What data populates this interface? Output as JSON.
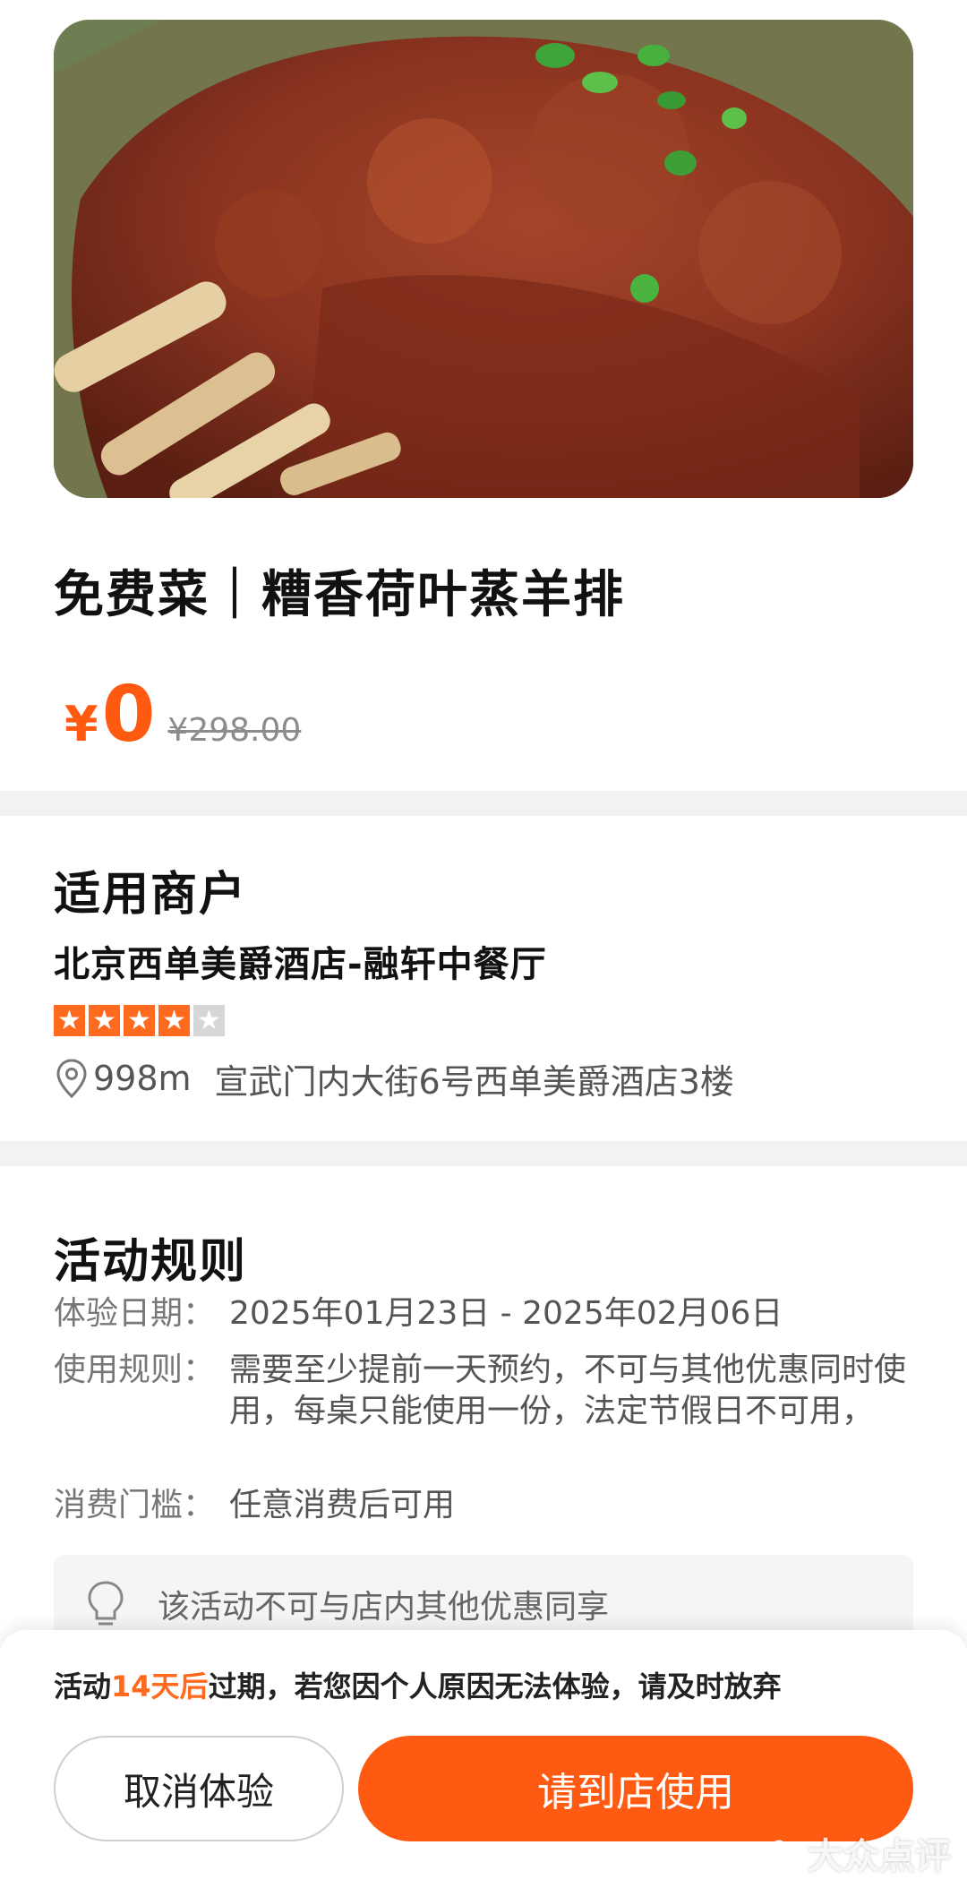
{
  "dish": {
    "title": "免费菜｜糟香荷叶蒸羊排",
    "price_symbol": "¥",
    "price_now": "0",
    "price_original": "¥298.00",
    "image_icon": "lamb-ribs-photo"
  },
  "merchant": {
    "section_title": "适用商户",
    "name": "北京西单美爵酒店-融轩中餐厅",
    "rating_stars": 4,
    "rating_max": 5,
    "distance": "998m",
    "address": "宣武门内大街6号西单美爵酒店3楼"
  },
  "rules": {
    "section_title": "活动规则",
    "items": [
      {
        "label": "体验日期：",
        "value": "2025年01月23日 - 2025年02月06日"
      },
      {
        "label": "使用规则：",
        "value": "需要至少提前一天预约，不可与其他优惠同时使用，每桌只能使用一份，法定节假日不可用，"
      },
      {
        "label": "消费门槛：",
        "value": "任意消费后可用"
      }
    ],
    "tip": "该活动不可与店内其他优惠同享"
  },
  "bottom": {
    "notice_prefix": "活动",
    "notice_highlight": "14天后",
    "notice_suffix": "过期，若您因个人原因无法体验，请及时放弃",
    "cancel_label": "取消体验",
    "use_label": "请到店使用",
    "watermark": "大众点评"
  },
  "colors": {
    "accent": "#ff5a12",
    "divider": "#f2f2f2"
  }
}
